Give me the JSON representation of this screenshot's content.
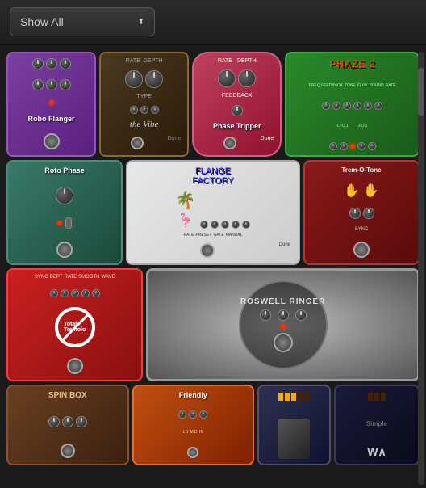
{
  "header": {
    "dropdown_label": "Show All",
    "dropdown_arrow": "⬍"
  },
  "pedals": {
    "row1": [
      {
        "id": "robo-flanger",
        "title": "Robo Flanger",
        "color_main": "#7b3fa0",
        "knobs": 6,
        "label": "Robo\nFlanger"
      },
      {
        "id": "the-vibe",
        "title": "the Vibe",
        "color_main": "#4a3a20",
        "knobs": 4,
        "label": "the Vibe"
      },
      {
        "id": "phase-tripper",
        "title": "Phase Tripper",
        "color_main": "#c04060",
        "knobs": 3,
        "label": "Phase Tripper"
      },
      {
        "id": "phaze2",
        "title": "PHAZE 2",
        "color_main": "#2a8a2a",
        "knobs": 8,
        "label": "PHAZE 2"
      }
    ],
    "row2": [
      {
        "id": "roto-phase",
        "title": "Roto Phase",
        "color_main": "#3a7a6a",
        "knobs": 2,
        "label": "Roto Phase"
      },
      {
        "id": "flange-factory",
        "title": "Flange Factory",
        "color_main": "#e8e8e8",
        "knobs": 5,
        "label": "FLANGE FACTORY"
      },
      {
        "id": "trem-o-tone",
        "title": "Trem-O-Tone",
        "color_main": "#8a1a1a",
        "knobs": 2,
        "label": "Trem-O-Tone"
      }
    ],
    "row3": [
      {
        "id": "total-tremolo",
        "title": "Total Tremolo",
        "color_main": "#cc2020",
        "label": "Total Tremolo"
      },
      {
        "id": "roswell-ringer",
        "title": "Roswell Ringer",
        "color_main": "#888888",
        "label": "ROSWELL RINGER"
      }
    ],
    "row4": [
      {
        "id": "spin-box",
        "title": "SPIN BOX",
        "color_main": "#6a4020",
        "label": "SPIN BOX"
      },
      {
        "id": "friendly",
        "title": "Friendly",
        "color_main": "#c05010",
        "label": "Friendly"
      },
      {
        "id": "mystery",
        "title": "",
        "color_main": "#303050",
        "label": ""
      },
      {
        "id": "wah",
        "title": "Wah",
        "color_main": "#1a1a3a",
        "label": "Wah"
      }
    ]
  }
}
